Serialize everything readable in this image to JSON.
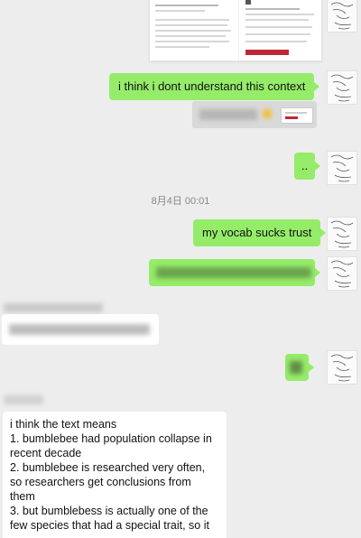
{
  "timestamp": "8月4日 00:01",
  "messages": {
    "m1": "i think i dont understand this context",
    "m2": "..",
    "m3": "my vocab sucks trust",
    "reply": "i think the text means\n1. bumblebee had population collapse in recent decade\n2. bumblebee is researched very often, so researchers get conclusions from them\n3. but bumblebess is actually one of the few species that had a special trait, so it"
  },
  "colors": {
    "background": "#ededed",
    "sent_bubble": "#95ec69",
    "received_bubble": "#ffffff"
  },
  "icons": {
    "avatar": "sketch-avatar-icon"
  }
}
